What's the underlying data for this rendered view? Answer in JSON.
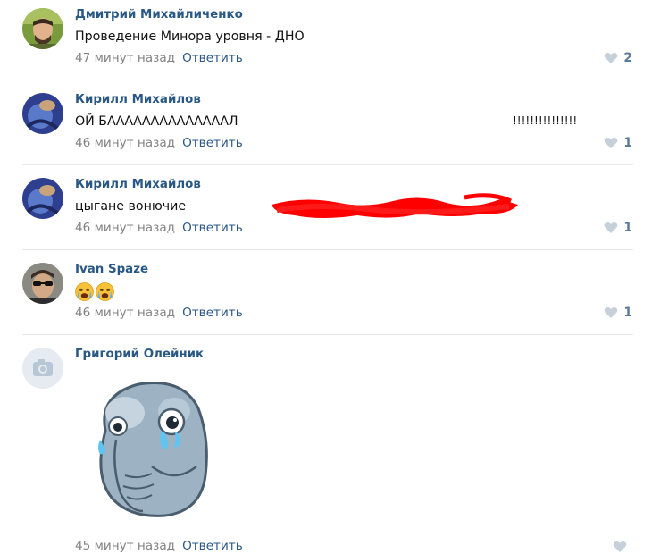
{
  "comments": [
    {
      "author": "Дмитрий Михайличенко",
      "text": "Проведение Минора уровня - ДНО",
      "time": "47 минут назад",
      "reply": "Ответить",
      "likes": "2"
    },
    {
      "author": "Кирилл Михайлов",
      "text_start": "ОЙ БААААААААААААААЛ",
      "text_end": "!!!!!!!!!!!!!!!",
      "time": "46 минут назад",
      "reply": "Ответить",
      "likes": "1"
    },
    {
      "author": "Кирилл Михайлов",
      "text": "цыгане вонючие",
      "time": "46 минут назад",
      "reply": "Ответить",
      "likes": "1"
    },
    {
      "author": "Ivan Spaze",
      "time": "46 минут назад",
      "reply": "Ответить",
      "likes": "1"
    },
    {
      "author": "Григорий Олейник",
      "time": "45 минут назад",
      "reply": "Ответить"
    }
  ],
  "colors": {
    "author": "#2a5885",
    "meta": "#828282",
    "like": "#5b7a99",
    "divider": "#e7e8ec",
    "redaction": "#ff0000"
  },
  "icons": [
    "heart-icon",
    "camera-icon",
    "crying-emoji-icon",
    "crying-elephant-sticker"
  ]
}
